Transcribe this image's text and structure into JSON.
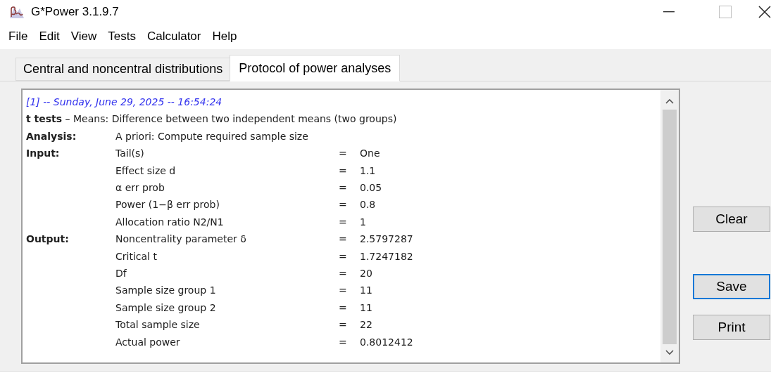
{
  "window": {
    "title": "G*Power 3.1.9.7"
  },
  "menu": [
    "File",
    "Edit",
    "View",
    "Tests",
    "Calculator",
    "Help"
  ],
  "tabs": [
    {
      "label": "Central and noncentral distributions",
      "selected": false
    },
    {
      "label": "Protocol of power analyses",
      "selected": true
    }
  ],
  "protocol": {
    "header": "[1] -- Sunday, June 29, 2025 -- 16:54:24",
    "test": "**t tests** – Means: Difference between two independent means (two groups)",
    "sections": [
      {
        "heading": "Analysis:",
        "text": "A priori: Compute required sample size"
      },
      {
        "heading": "Input:",
        "params": [
          {
            "name": "Tail(s)",
            "sign": "=",
            "value": "One"
          },
          {
            "name": "Effect size d",
            "sign": "=",
            "value": "1.1"
          },
          {
            "name": "α err prob",
            "sign": "=",
            "value": "0.05"
          },
          {
            "name": "Power (1−β err prob)",
            "sign": "=",
            "value": "0.8"
          },
          {
            "name": "Allocation ratio N2/N1",
            "sign": "=",
            "value": "1"
          }
        ]
      },
      {
        "heading": "Output:",
        "params": [
          {
            "name": "Noncentrality parameter δ",
            "sign": "=",
            "value": "2.5797287"
          },
          {
            "name": "Critical t",
            "sign": "=",
            "value": "1.7247182"
          },
          {
            "name": "Df",
            "sign": "=",
            "value": "20"
          },
          {
            "name": "Sample size group 1",
            "sign": "=",
            "value": "11"
          },
          {
            "name": "Sample size group 2",
            "sign": "=",
            "value": "11"
          },
          {
            "name": "Total sample size",
            "sign": "=",
            "value": "22"
          },
          {
            "name": "Actual power",
            "sign": "=",
            "value": "0.8012412"
          }
        ]
      }
    ]
  },
  "buttons": [
    {
      "label": "Clear",
      "focused": false
    },
    {
      "label": "Save",
      "focused": true
    },
    {
      "label": "Print",
      "focused": false
    }
  ]
}
